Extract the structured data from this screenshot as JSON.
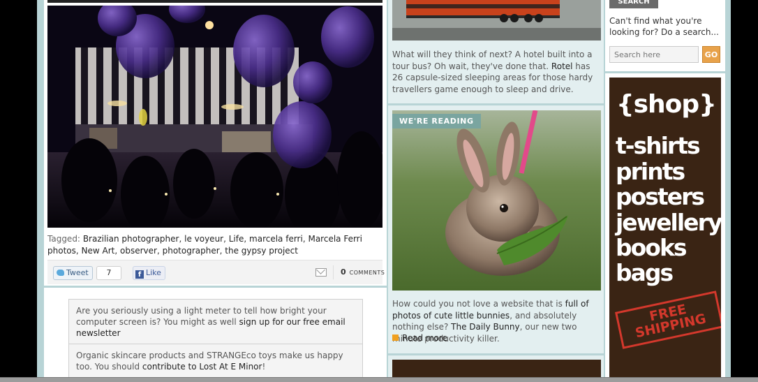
{
  "left": {
    "tags_label": "Tagged:",
    "tags": [
      "Brazilian photographer",
      "le voyeur",
      "Life",
      "marcela ferri",
      "Marcela Ferri photos",
      "New Art",
      "observer",
      "photographer",
      "the gypsy project"
    ],
    "share": {
      "tweet_label": "Tweet",
      "tweet_count": "7",
      "like_label": "Like",
      "comments_count": "0",
      "comments_label": "comments"
    },
    "notes": [
      {
        "text_before": "Are you seriously using a light meter to tell how bright your computer screen is? You might as well ",
        "link": "sign up for our free email newsletter",
        "text_after": ""
      },
      {
        "text_before": "Organic skincare products and STRANGEco toys make us happy too. You should ",
        "link": "contribute to Lost At E Minor",
        "text_after": "!"
      }
    ]
  },
  "middle": {
    "post1": {
      "text_before": "What will they think of next? A hotel built into a tour bus? Oh wait, they've done that. ",
      "link": "Rotel",
      "text_after": " has 26 capsule-sized sleeping areas for those hardy travellers game enough to sleep and drive."
    },
    "badge": "WE'RE READING",
    "post2": {
      "t1": "How could you not love a website that is ",
      "l1": "full of photos of cute little bunnies",
      "t2": ", and absolutely nothing else? ",
      "l2": "The Daily Bunny",
      "t3": ", our new two minute productivity killer."
    },
    "read_more": "Read more"
  },
  "right": {
    "search_tab": "SEARCH",
    "search_help": "Can't find what you're looking for? Do a search...",
    "search_placeholder": "Search here",
    "go_label": "GO",
    "shop_title": "{shop}",
    "shop_items": [
      "t-shirts",
      "prints",
      "posters",
      "jewellery",
      "books",
      "bags"
    ],
    "stamp_line1": "FREE",
    "stamp_line2": "SHIPPING"
  },
  "colors": {
    "page_bg": "#b8d4d6",
    "shop_bg": "#3a2414",
    "go_button": "#e8a24a",
    "badge": "#7aa5a0",
    "stamp": "#d4382c"
  }
}
